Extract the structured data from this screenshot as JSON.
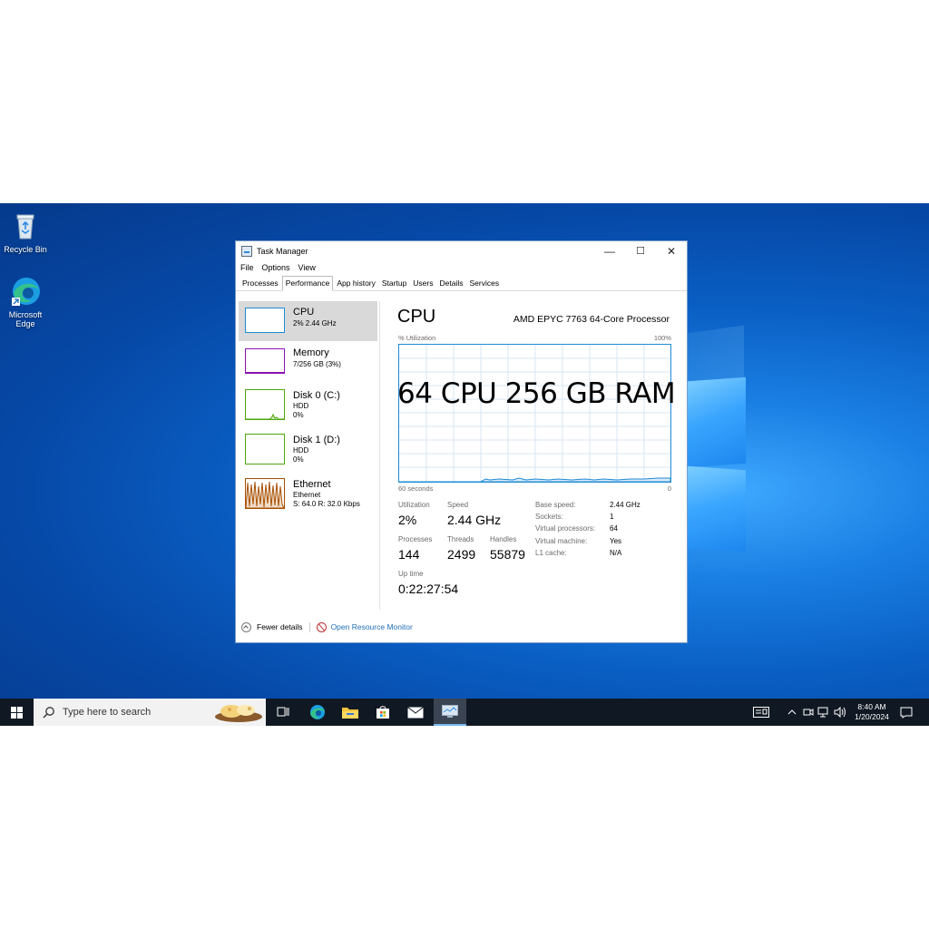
{
  "desktop": {
    "icons": [
      {
        "label_line1": "Recycle Bin",
        "label_line2": ""
      },
      {
        "label_line1": "Microsoft",
        "label_line2": "Edge"
      }
    ]
  },
  "window": {
    "title": "Task Manager",
    "menu": [
      "File",
      "Options",
      "View"
    ],
    "tabs": [
      "Processes",
      "Performance",
      "App history",
      "Startup",
      "Users",
      "Details",
      "Services"
    ],
    "active_tab": "Performance",
    "controls": {
      "minimize": "—",
      "maximize": "☐",
      "close": "✕"
    }
  },
  "resources": [
    {
      "name": "CPU",
      "sub1": "2% 2.44 GHz",
      "sub2": "",
      "sub3": "",
      "color": "#1f8ad6"
    },
    {
      "name": "Memory",
      "sub1": "7/256 GB (3%)",
      "sub2": "",
      "sub3": "",
      "color": "#8b12ae"
    },
    {
      "name": "Disk 0 (C:)",
      "sub1": "HDD",
      "sub2": "0%",
      "sub3": "",
      "color": "#4da60c"
    },
    {
      "name": "Disk 1 (D:)",
      "sub1": "HDD",
      "sub2": "0%",
      "sub3": "",
      "color": "#4da60c"
    },
    {
      "name": "Ethernet",
      "sub1": "Ethernet",
      "sub2": "S: 64.0 R: 32.0 Kbps",
      "sub3": "",
      "color": "#a74f01"
    }
  ],
  "detail": {
    "title": "CPU",
    "processor": "AMD EPYC 7763 64-Core Processor",
    "graph_label_left": "% Utilization",
    "graph_label_right": "100%",
    "graph_bottom_left": "60 seconds",
    "graph_bottom_right": "0",
    "overlay_text": "64 CPU 256 GB RAM",
    "stats": {
      "utilization_label": "Utilization",
      "utilization": "2%",
      "speed_label": "Speed",
      "speed": "2.44 GHz",
      "processes_label": "Processes",
      "processes": "144",
      "threads_label": "Threads",
      "threads": "2499",
      "handles_label": "Handles",
      "handles": "55879",
      "uptime_label": "Up time",
      "uptime": "0:22:27:54"
    },
    "specs": [
      {
        "key": "Base speed:",
        "value": "2.44 GHz"
      },
      {
        "key": "Sockets:",
        "value": "1"
      },
      {
        "key": "Virtual processors:",
        "value": "64"
      },
      {
        "key": "Virtual machine:",
        "value": "Yes"
      },
      {
        "key": "L1 cache:",
        "value": "N/A"
      }
    ]
  },
  "footer": {
    "fewer_details": "Fewer details",
    "resource_monitor": "Open Resource Monitor"
  },
  "taskbar": {
    "search_placeholder": "Type here to search",
    "time": "8:40 AM",
    "date": "1/20/2024"
  },
  "colors": {
    "cpu_accent": "#1f8ad6",
    "memory_accent": "#8b12ae",
    "disk_accent": "#4da60c",
    "ethernet_accent": "#a74f01",
    "link": "#1f6fb5"
  }
}
